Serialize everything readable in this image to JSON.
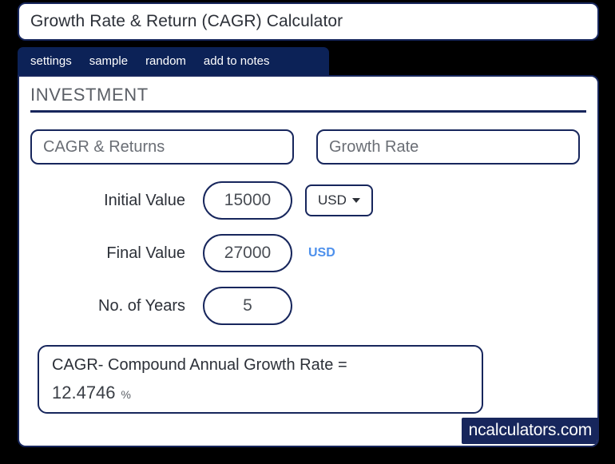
{
  "window": {
    "title": "Growth Rate & Return (CAGR) Calculator"
  },
  "toolbar": {
    "items": [
      {
        "label": "settings"
      },
      {
        "label": "sample"
      },
      {
        "label": "random"
      },
      {
        "label": "add to notes"
      }
    ]
  },
  "section": {
    "heading": "INVESTMENT"
  },
  "modes": [
    {
      "label": "CAGR & Returns"
    },
    {
      "label": "Growth Rate"
    }
  ],
  "form": {
    "rows": [
      {
        "label": "Initial Value",
        "value": "15000",
        "unit_select": "USD",
        "unit_static": ""
      },
      {
        "label": "Final Value",
        "value": "27000",
        "unit_select": "",
        "unit_static": "USD"
      },
      {
        "label": "No. of Years",
        "value": "5",
        "unit_select": "",
        "unit_static": ""
      }
    ]
  },
  "result": {
    "label": "CAGR- Compound Annual Growth Rate  =",
    "value": "12.4746",
    "unit": "%"
  },
  "footer": {
    "watermark": "ncalculators.com"
  },
  "colors": {
    "navy": "#17265c",
    "tabbar_navy": "#0c2257",
    "accent_blue": "#4d90ec",
    "page_background": "#000000",
    "panel_background": "#ffffff",
    "label_gray": "#2c3038",
    "muted_gray": "#6a6e75"
  }
}
